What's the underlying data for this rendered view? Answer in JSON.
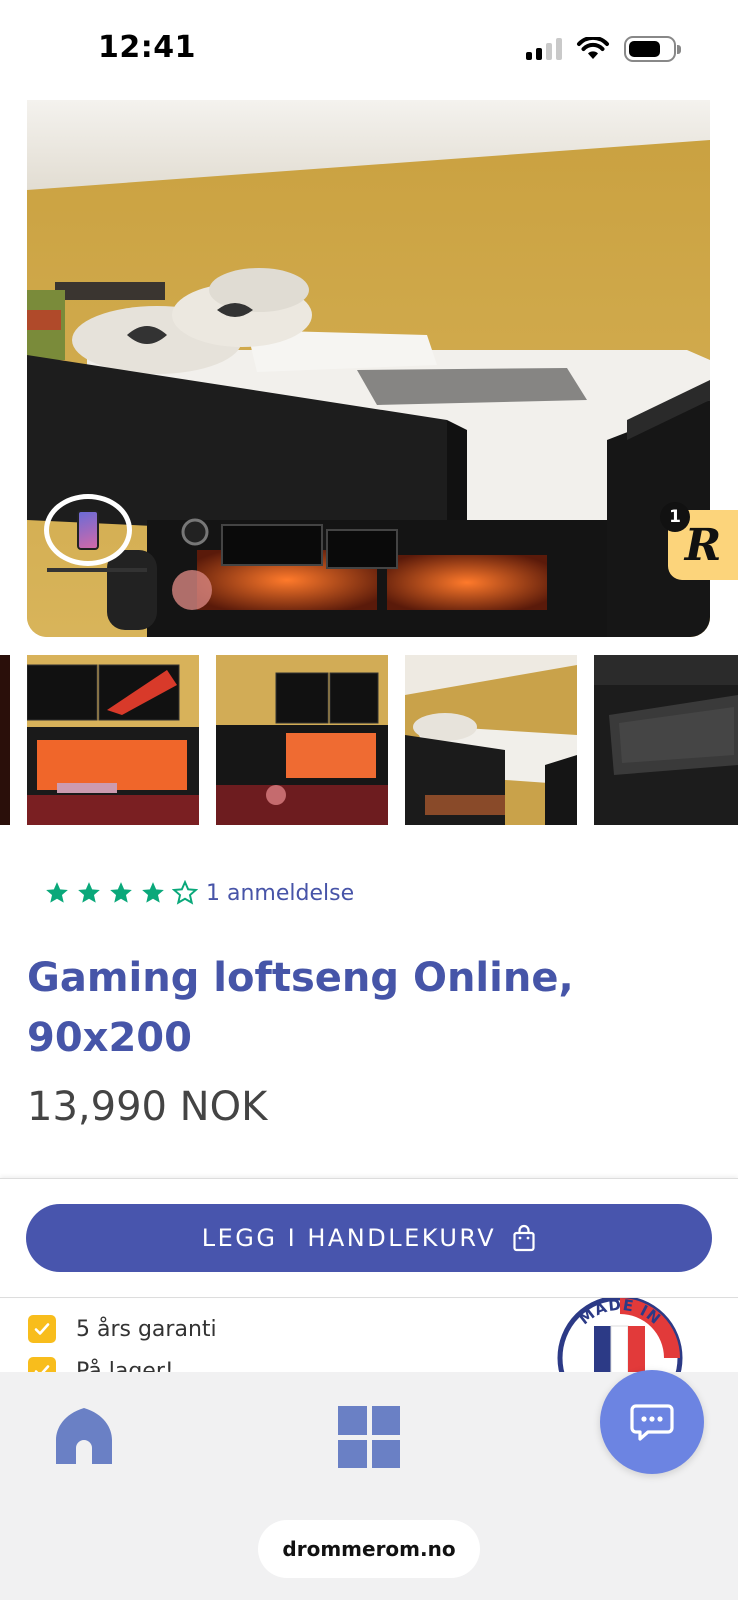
{
  "status_bar": {
    "time": "12:41"
  },
  "product": {
    "rating_value": 4,
    "rating_max": 5,
    "reviews_label": "1 anmeldelse",
    "title": "Gaming loftseng Online, 90x200",
    "price": "13,990 NOK"
  },
  "gallery": {
    "thumbnail_count": 5
  },
  "reviews_widget": {
    "badge_count": "1",
    "logo_letter": "R"
  },
  "cart": {
    "button_label": "LEGG I HANDLEKURV"
  },
  "features": [
    {
      "label": "5 års garanti"
    },
    {
      "label": "På lager!"
    }
  ],
  "badge": {
    "text": "MADE IN"
  },
  "browser": {
    "url": "drommerom.no"
  },
  "colors": {
    "brand_blue": "#4855ad",
    "title_blue": "#4655a8",
    "star_green": "#0aa87a",
    "check_yellow": "#f8bd1c",
    "chat_blue": "#6c84e2",
    "reviews_tab": "#fcd47b"
  },
  "icons": {
    "status": [
      "signal-icon",
      "wifi-icon",
      "battery-icon"
    ],
    "cart": "shopping-bag-icon",
    "nav": [
      "home-icon",
      "grid-icon"
    ],
    "chat": "chat-icon"
  }
}
